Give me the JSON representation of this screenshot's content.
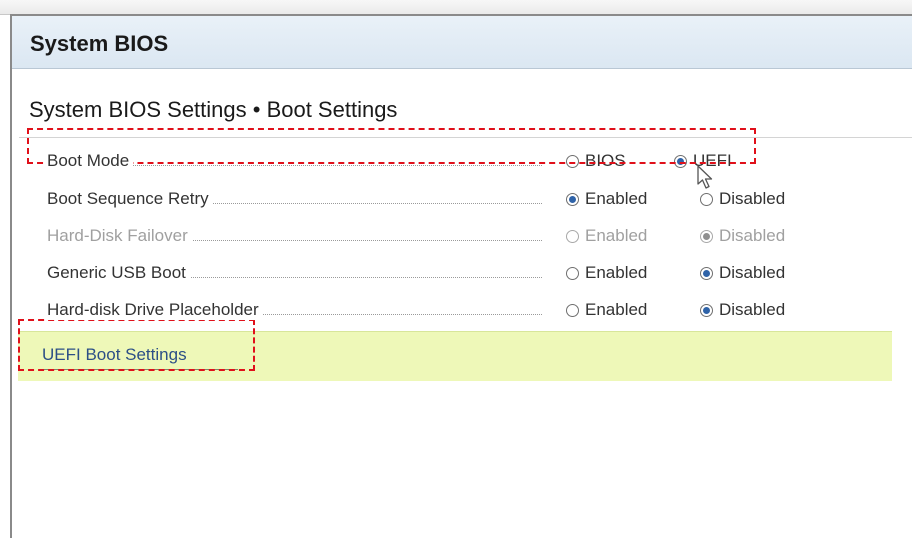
{
  "window": {
    "title": "System BIOS"
  },
  "section": {
    "title": "System BIOS Settings • Boot Settings"
  },
  "settings": [
    {
      "label": "Boot Mode",
      "enabled": true,
      "options": [
        {
          "label": "BIOS",
          "checked": false
        },
        {
          "label": "UEFI",
          "checked": true
        }
      ]
    },
    {
      "label": "Boot Sequence Retry",
      "enabled": true,
      "options": [
        {
          "label": "Enabled",
          "checked": true
        },
        {
          "label": "Disabled",
          "checked": false
        }
      ]
    },
    {
      "label": "Hard-Disk Failover",
      "enabled": false,
      "options": [
        {
          "label": "Enabled",
          "checked": false
        },
        {
          "label": "Disabled",
          "checked": true
        }
      ]
    },
    {
      "label": "Generic USB Boot",
      "enabled": true,
      "options": [
        {
          "label": "Enabled",
          "checked": false
        },
        {
          "label": "Disabled",
          "checked": true
        }
      ]
    },
    {
      "label": "Hard-disk Drive Placeholder",
      "enabled": true,
      "options": [
        {
          "label": "Enabled",
          "checked": false
        },
        {
          "label": "Disabled",
          "checked": true
        }
      ]
    }
  ],
  "submenu": {
    "label": "UEFI Boot Settings"
  },
  "colors": {
    "accent": "#2f63a8",
    "highlight": "#eef8b8",
    "annotation": "#e0101a",
    "title_bar": "#dbe7f2"
  },
  "icons": {
    "cursor": "mouse-pointer-icon",
    "radio": "radio-button-icon"
  }
}
